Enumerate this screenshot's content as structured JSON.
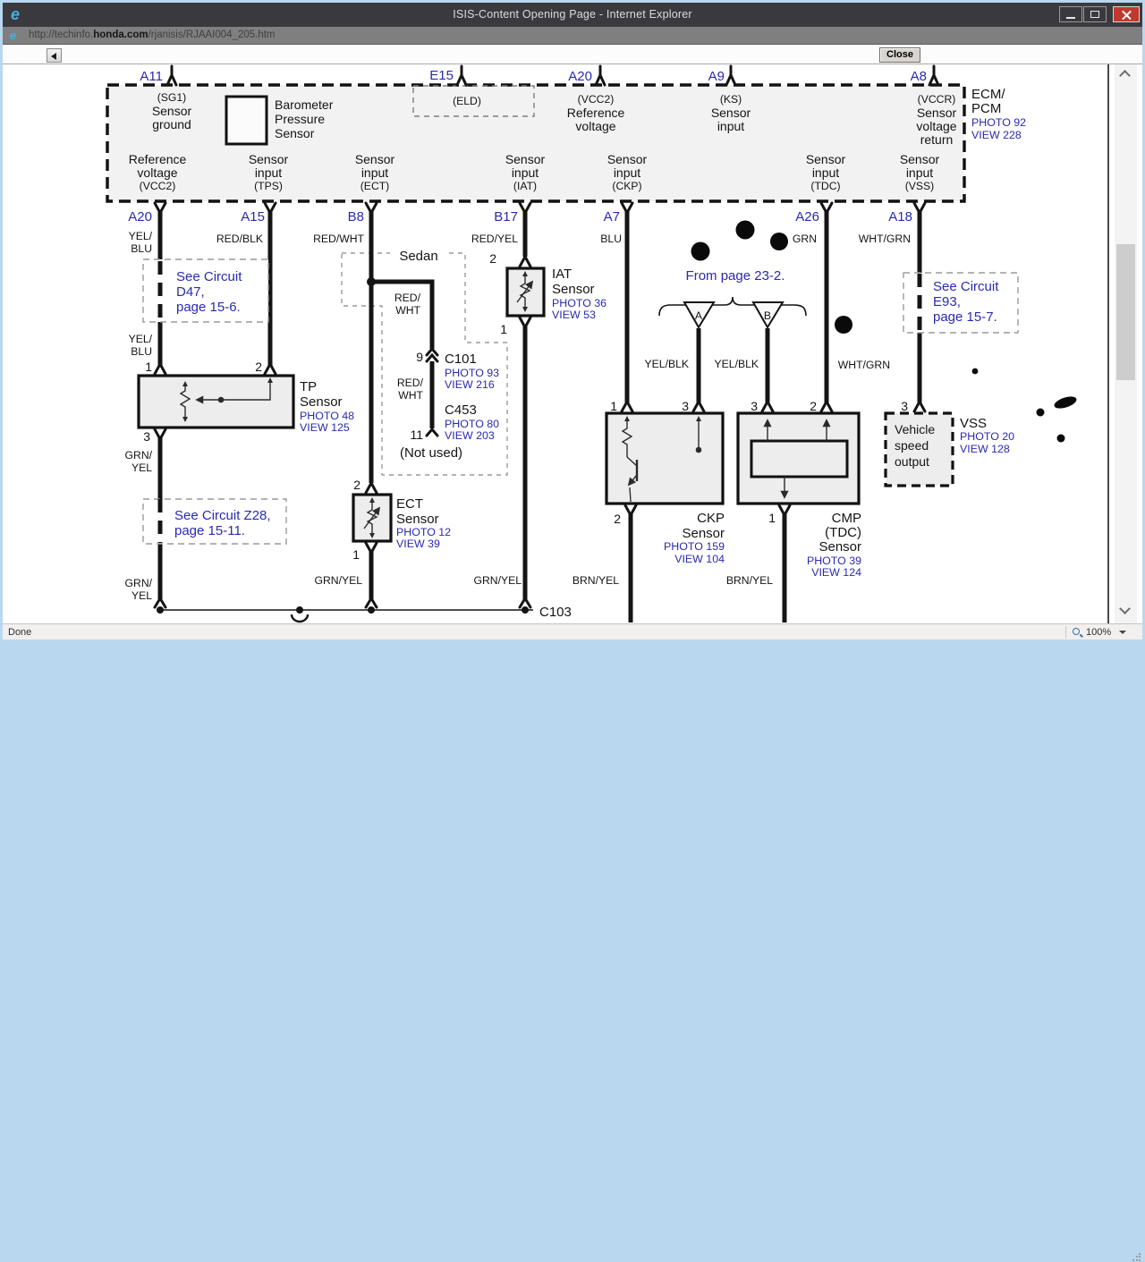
{
  "colors": {
    "link_blue": "#2a2ab0",
    "titlebar_bg": "#3a3a3e",
    "addressbar_bg": "#7f7f7f",
    "close_red": "#c0392f",
    "diagram_ink": "#141414",
    "window_border": "#b9d7ef"
  },
  "icons": {
    "ie_logo": "e"
  },
  "window": {
    "title": "ISIS-Content Opening Page - Internet Explorer"
  },
  "address": {
    "protocol": "http://techinfo.",
    "domain": "honda.com",
    "path": "/rjanisis/RJAAI004_205.htm"
  },
  "toolbar": {
    "close_label": "Close"
  },
  "statusbar": {
    "status": "Done",
    "zoom_level": "100%"
  },
  "ecm": {
    "top_pins": {
      "p1": "A11",
      "p2": "E15",
      "p3": "A20",
      "p4": "A9",
      "p5": "A8"
    },
    "eld": "(ELD)",
    "sg1": {
      "l1": "(SG1)",
      "l2": "Sensor",
      "l3": "ground"
    },
    "baro": {
      "l1": "Barometer",
      "l2": "Pressure",
      "l3": "Sensor"
    },
    "vcc2": {
      "l1": "(VCC2)",
      "l2": "Reference",
      "l3": "voltage"
    },
    "ks": {
      "l1": "(KS)",
      "l2": "Sensor",
      "l3": "input"
    },
    "vccr": {
      "l1": "(VCCR)",
      "l2": "Sensor",
      "l3": "voltage",
      "l4": "return"
    },
    "refv": {
      "l1": "Reference",
      "l2": "voltage",
      "l3": "(VCC2)"
    },
    "tps": {
      "l1": "Sensor",
      "l2": "input",
      "l3": "(TPS)"
    },
    "ectc": {
      "l1": "Sensor",
      "l2": "input",
      "l3": "(ECT)"
    },
    "iatc": {
      "l1": "Sensor",
      "l2": "input",
      "l3": "(IAT)"
    },
    "ckpc": {
      "l1": "Sensor",
      "l2": "input",
      "l3": "(CKP)"
    },
    "tdcc": {
      "l1": "Sensor",
      "l2": "input",
      "l3": "(TDC)"
    },
    "vssc": {
      "l1": "Sensor",
      "l2": "input",
      "l3": "(VSS)"
    },
    "name1": "ECM/",
    "name2": "PCM",
    "photo": "PHOTO 92",
    "view": "VIEW 228"
  },
  "pins": {
    "a20": "A20",
    "a15": "A15",
    "b8": "B8",
    "b17": "B17",
    "a7": "A7",
    "a26": "A26",
    "a18": "A18",
    "w_a20a": "YEL/",
    "w_a20b": "BLU",
    "w_a15": "RED/BLK",
    "w_b8": "RED/WHT",
    "w_b17": "RED/YEL",
    "w_a7": "BLU",
    "w_a26": "GRN",
    "w_a18": "WHT/GRN"
  },
  "notes": {
    "d47": {
      "l1": "See Circuit",
      "l2": "D47,",
      "l3": "page 15-6."
    },
    "z28": {
      "l1": "See Circuit Z28,",
      "l2": "page 15-11."
    },
    "e93": {
      "l1": "See Circuit",
      "l2": "E93,",
      "l3": "page 15-7."
    },
    "from_page": "From page 23-2.",
    "sedan": "Sedan",
    "not_used": "(Not used)",
    "tri_a": "A",
    "tri_b": "B"
  },
  "wires": {
    "yel2a": "YEL/",
    "yel2b": "BLU",
    "grn1a": "GRN/",
    "grn1b": "YEL",
    "grn2a": "GRN/",
    "grn2b": "YEL",
    "redwht1a": "RED/",
    "redwht1b": "WHT",
    "redwht2a": "RED/",
    "redwht2b": "WHT",
    "grnyel_ect": "GRN/YEL",
    "grnyel_iat": "GRN/YEL",
    "brnyel_ckp": "BRN/YEL",
    "brnyel_cmp": "BRN/YEL",
    "yelblk_a": "YEL/BLK",
    "yelblk_b": "YEL/BLK",
    "whtgrn2": "WHT/GRN"
  },
  "conn": {
    "c101": {
      "pin": "9",
      "name": "C101",
      "photo": "PHOTO 93",
      "view": "VIEW 216"
    },
    "c453": {
      "pin": "11",
      "name": "C453",
      "photo": "PHOTO 80",
      "view": "VIEW 203"
    },
    "c103": "C103"
  },
  "tp": {
    "pin1": "1",
    "pin2": "2",
    "pin3": "3",
    "n1": "TP",
    "n2": "Sensor",
    "photo": "PHOTO 48",
    "view": "VIEW 125"
  },
  "iat": {
    "pin2": "2",
    "pin1": "1",
    "n1": "IAT",
    "n2": "Sensor",
    "photo": "PHOTO 36",
    "view": "VIEW 53"
  },
  "ect": {
    "pin2": "2",
    "pin1": "1",
    "n1": "ECT",
    "n2": "Sensor",
    "photo": "PHOTO 12",
    "view": "VIEW 39"
  },
  "ckp": {
    "pin1": "1",
    "pin3": "3",
    "pin2": "2",
    "n1": "CKP",
    "n2": "Sensor",
    "photo": "PHOTO 159",
    "view": "VIEW 104"
  },
  "cmp": {
    "pin3": "3",
    "pin2": "2",
    "pin1": "1",
    "n1": "CMP",
    "n2": "(TDC)",
    "n3": "Sensor",
    "photo": "PHOTO 39",
    "view": "VIEW 124"
  },
  "vss": {
    "pin3": "3",
    "b1": "Vehicle",
    "b2": "speed",
    "b3": "output",
    "n1": "VSS",
    "photo": "PHOTO 20",
    "view": "VIEW 128"
  }
}
